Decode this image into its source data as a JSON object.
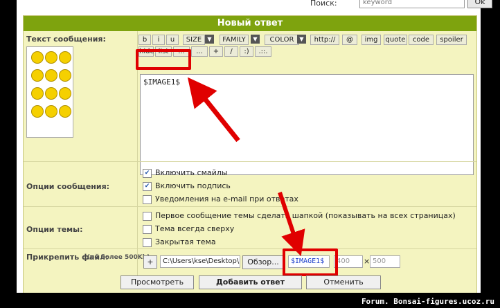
{
  "top": {
    "search_label": "Поиск:",
    "search_value": "keyword",
    "ok_label": "Ok"
  },
  "form": {
    "title": "Новый ответ",
    "message_label": "Текст сообщения:",
    "toolbar": [
      "b",
      "i",
      "u",
      "SIZE",
      "FAMILY",
      "COLOR",
      "http://",
      "@",
      "img",
      "quote",
      "code",
      "spoiler"
    ],
    "toolbar_row2": [
      "hide",
      "list",
      "...",
      "...",
      "+",
      "/",
      ":)",
      ".::."
    ],
    "message_text": "$IMAGE1$",
    "msg_options_label": "Опции сообщения:",
    "msg_options": [
      {
        "label": "Включить смайлы",
        "checked": true
      },
      {
        "label": "Включить подпись",
        "checked": true
      },
      {
        "label": "Уведомления на e-mail при ответах",
        "checked": false
      }
    ],
    "topic_options_label": "Опции темы:",
    "topic_options": [
      {
        "label": "Первое сообщение темы сделать шапкой (показывать на всех страницах)",
        "checked": false
      },
      {
        "label": "Тема всегда сверху",
        "checked": false
      },
      {
        "label": "Закрытая тема",
        "checked": false
      }
    ],
    "attach_label": "Прикрепить файл:",
    "attach_note": "(не более 500Kb)",
    "attach_plus": "+",
    "file_path": "C:\\Users\\kse\\Desktop\\",
    "browse_label": "Обзор...",
    "image_code": "$IMAGE1$",
    "width_placeholder": "400",
    "times": "×",
    "height_placeholder": "500",
    "preview_btn": "Просмотреть",
    "submit_btn": "Добавить ответ",
    "cancel_btn": "Отменить"
  },
  "watermark": "Forum. Bonsai-figures.ucoz.ru",
  "colors": {
    "header": "#7ea30e",
    "panel": "#f4f4c0",
    "highlight": "#e00000"
  }
}
